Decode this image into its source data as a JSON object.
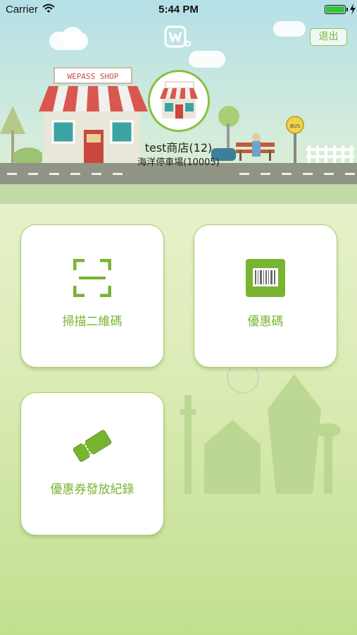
{
  "status_bar": {
    "carrier": "Carrier",
    "time": "5:44 PM",
    "battery_level": 1.0
  },
  "header": {
    "shop_sign_text": "WEPASS SHOP",
    "bus_sign_text": "BUS",
    "logout_label": "退出",
    "store_name": "test商店(12)",
    "store_location": "海洋停車場(10005)"
  },
  "menu": {
    "items": [
      {
        "label": "掃描二維碼",
        "icon": "qr-scan-icon"
      },
      {
        "label": "優惠碼",
        "icon": "barcode-icon"
      },
      {
        "label": "優惠券發放紀錄",
        "icon": "coupon-ticket-icon"
      }
    ]
  },
  "colors": {
    "accent_green": "#79b431",
    "tile_border": "#a6d06a",
    "sky_top": "#b5e0e8",
    "ground_bottom": "#c2df8f"
  }
}
